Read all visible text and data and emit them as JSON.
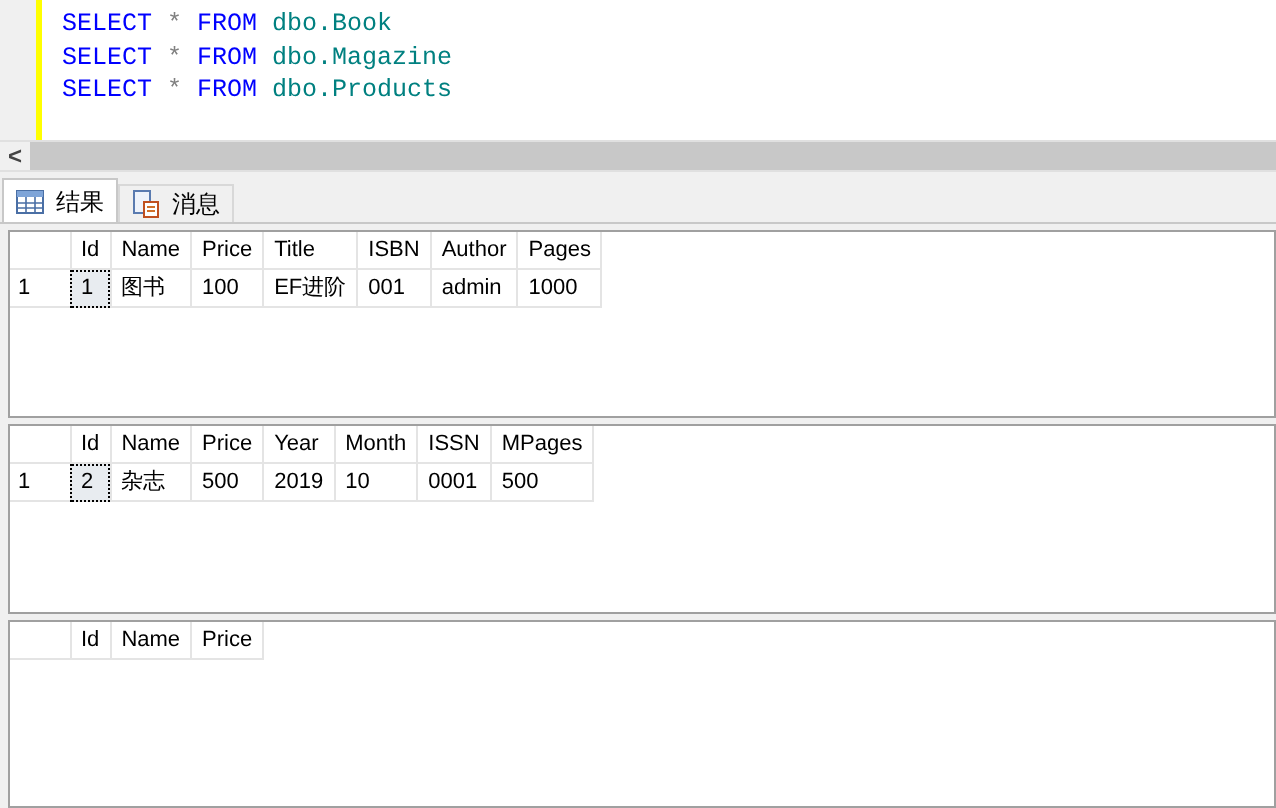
{
  "editor": {
    "lines": [
      [
        {
          "kind": "keyword",
          "text": "SELECT"
        },
        {
          "kind": "operator",
          "text": "*"
        },
        {
          "kind": "keyword",
          "text": "FROM"
        },
        {
          "kind": "identifier",
          "text": "dbo.Book"
        }
      ],
      [
        {
          "kind": "keyword",
          "text": "SELECT"
        },
        {
          "kind": "operator",
          "text": "*"
        },
        {
          "kind": "keyword",
          "text": "FROM"
        },
        {
          "kind": "identifier",
          "text": "dbo.Magazine"
        }
      ],
      [
        {
          "kind": "keyword",
          "text": "SELECT"
        },
        {
          "kind": "operator",
          "text": "*"
        },
        {
          "kind": "keyword",
          "text": "FROM"
        },
        {
          "kind": "identifier",
          "text": "dbo.Products"
        }
      ]
    ]
  },
  "scrollbar": {
    "left_arrow": "<"
  },
  "tabs": [
    {
      "label": "结果",
      "kind": "grid",
      "selected": true
    },
    {
      "label": "消息",
      "kind": "messages",
      "selected": false
    }
  ],
  "grids": [
    {
      "columns": [
        "Id",
        "Name",
        "Price",
        "Title",
        "ISBN",
        "Author",
        "Pages"
      ],
      "rows": [
        {
          "number": "1",
          "id_cell_focused": true,
          "cells": [
            "1",
            "图书",
            "100",
            "EF进阶",
            "001",
            "admin",
            "1000"
          ]
        }
      ]
    },
    {
      "columns": [
        "Id",
        "Name",
        "Price",
        "Year",
        "Month",
        "ISSN",
        "MPages"
      ],
      "rows": [
        {
          "number": "1",
          "id_cell_focused": true,
          "cells": [
            "2",
            "杂志",
            "500",
            "2019",
            "10",
            "0001",
            "500"
          ]
        }
      ]
    },
    {
      "columns": [
        "Id",
        "Name",
        "Price"
      ]
    }
  ]
}
